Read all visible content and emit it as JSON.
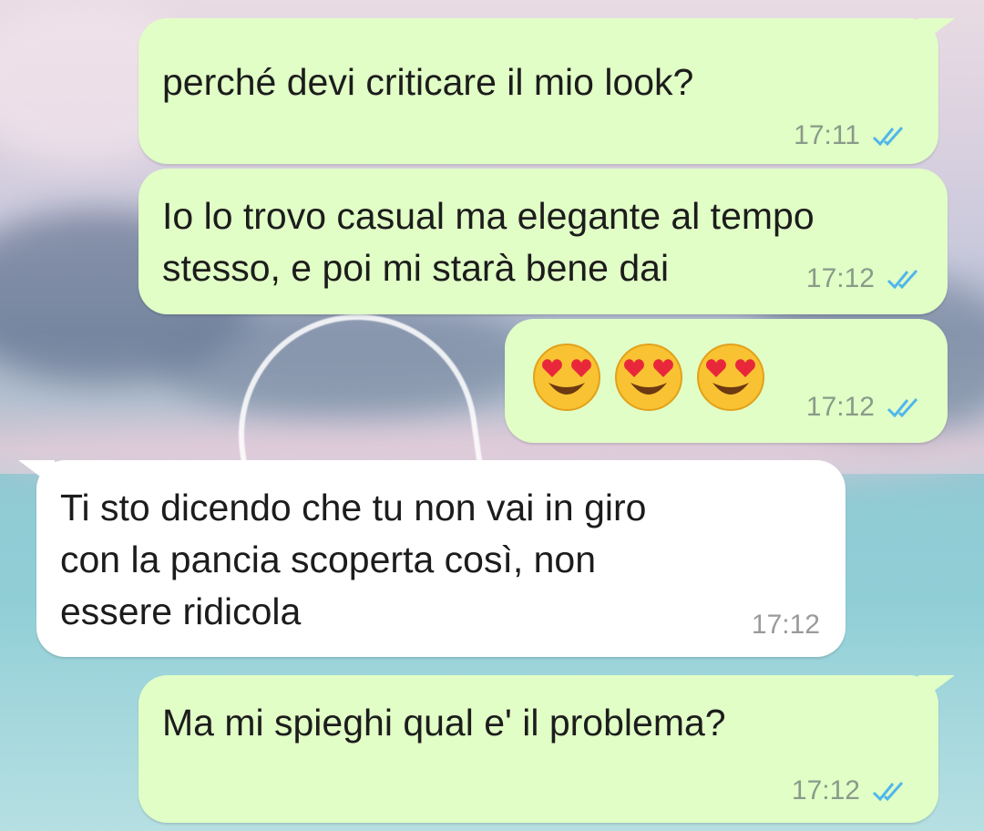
{
  "messages": [
    {
      "direction": "outgoing",
      "text": "perché devi criticare il mio look?",
      "time": "17:11",
      "status": "read"
    },
    {
      "direction": "outgoing",
      "text": "Io lo trovo casual ma elegante al tempo\nstesso, e poi mi starà bene dai",
      "time": "17:12",
      "status": "read"
    },
    {
      "direction": "outgoing",
      "emoji": [
        "heart-eyes-emoji",
        "heart-eyes-emoji",
        "heart-eyes-emoji"
      ],
      "time": "17:12",
      "status": "read"
    },
    {
      "direction": "incoming",
      "text": "Ti sto dicendo che tu non vai in giro\ncon la pancia scoperta così, non\nessere ridicola",
      "time": "17:12"
    },
    {
      "direction": "outgoing",
      "text": "Ma mi spieghi qual e' il problema?",
      "time": "17:12",
      "status": "read"
    }
  ],
  "colors": {
    "outgoing_bubble": "#e1fec6",
    "incoming_bubble": "#ffffff",
    "read_ticks": "#4fb6ec"
  },
  "icons": {
    "read_receipt": "double-check-icon"
  }
}
